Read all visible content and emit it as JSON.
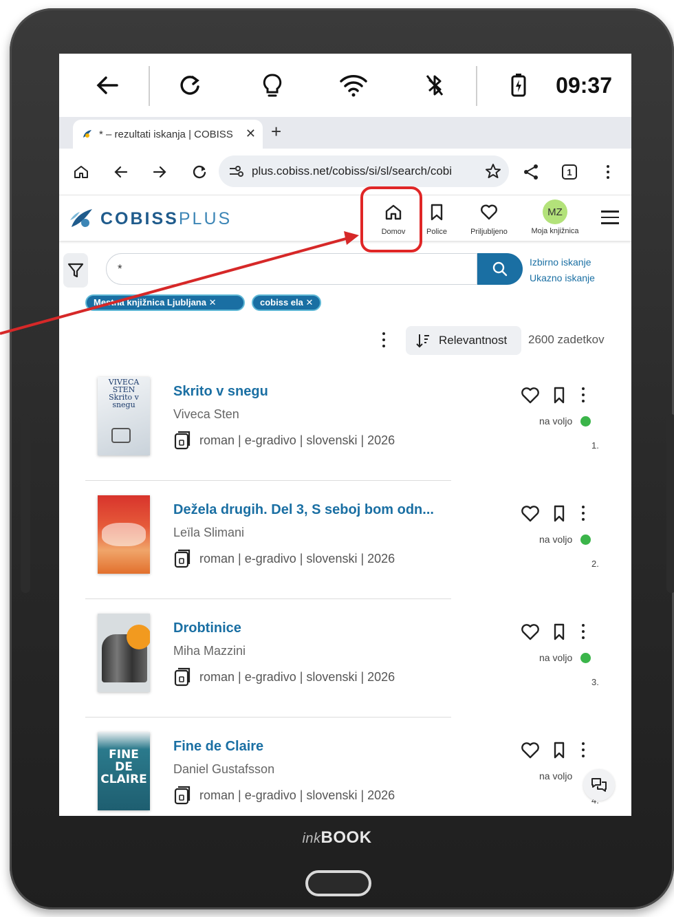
{
  "device": {
    "brand_ink": "ink",
    "brand_book": "BOOK"
  },
  "statusbar": {
    "time": "09:37"
  },
  "tab": {
    "title": "* – rezultati iskanja | COBISS",
    "close": "✕",
    "new": "+"
  },
  "address": {
    "url": "plus.cobiss.net/cobiss/si/sl/search/cobi",
    "tab_count": "1"
  },
  "site": {
    "logo_bold": "COBISS",
    "logo_plus": "PLUS",
    "nav": [
      {
        "label": "Domov"
      },
      {
        "label": "Police"
      },
      {
        "label": "Priljubljeno"
      },
      {
        "label": "Moja knjižnica",
        "avatar": "MZ"
      }
    ]
  },
  "search": {
    "value": "*",
    "advanced": "Izbirno iskanje",
    "command": "Ukazno iskanje",
    "chips": [
      "Mestna knjižnica Ljubljana ✕",
      "cobiss ela ✕"
    ]
  },
  "sort": {
    "label": "Relevantnost",
    "count": "2600 zadetkov"
  },
  "results": [
    {
      "title": "Skrito v snegu",
      "author": "Viveca Sten",
      "meta": "roman | e-gradivo | slovenski | 2026",
      "availability": "na voljo",
      "number": "1.",
      "cover_text": "VIVECA STEN Skrito v snegu"
    },
    {
      "title": "Dežela drugih. Del 3, S seboj bom odn...",
      "author": "Leïla Slimani",
      "meta": "roman | e-gradivo | slovenski | 2026",
      "availability": "na voljo",
      "number": "2."
    },
    {
      "title": "Drobtinice",
      "author": "Miha Mazzini",
      "meta": "roman | e-gradivo | slovenski | 2026",
      "availability": "na voljo",
      "number": "3."
    },
    {
      "title": "Fine de Claire",
      "author": "Daniel Gustafsson",
      "meta": "roman | e-gradivo | slovenski | 2026",
      "availability": "na voljo",
      "number": "4.",
      "cover_text": "FINE DE CLAIRE"
    }
  ],
  "colors": {
    "accent": "#1a6fa3",
    "highlight": "#e02626",
    "available": "#3bb54a",
    "avatar": "#b3e27a"
  }
}
